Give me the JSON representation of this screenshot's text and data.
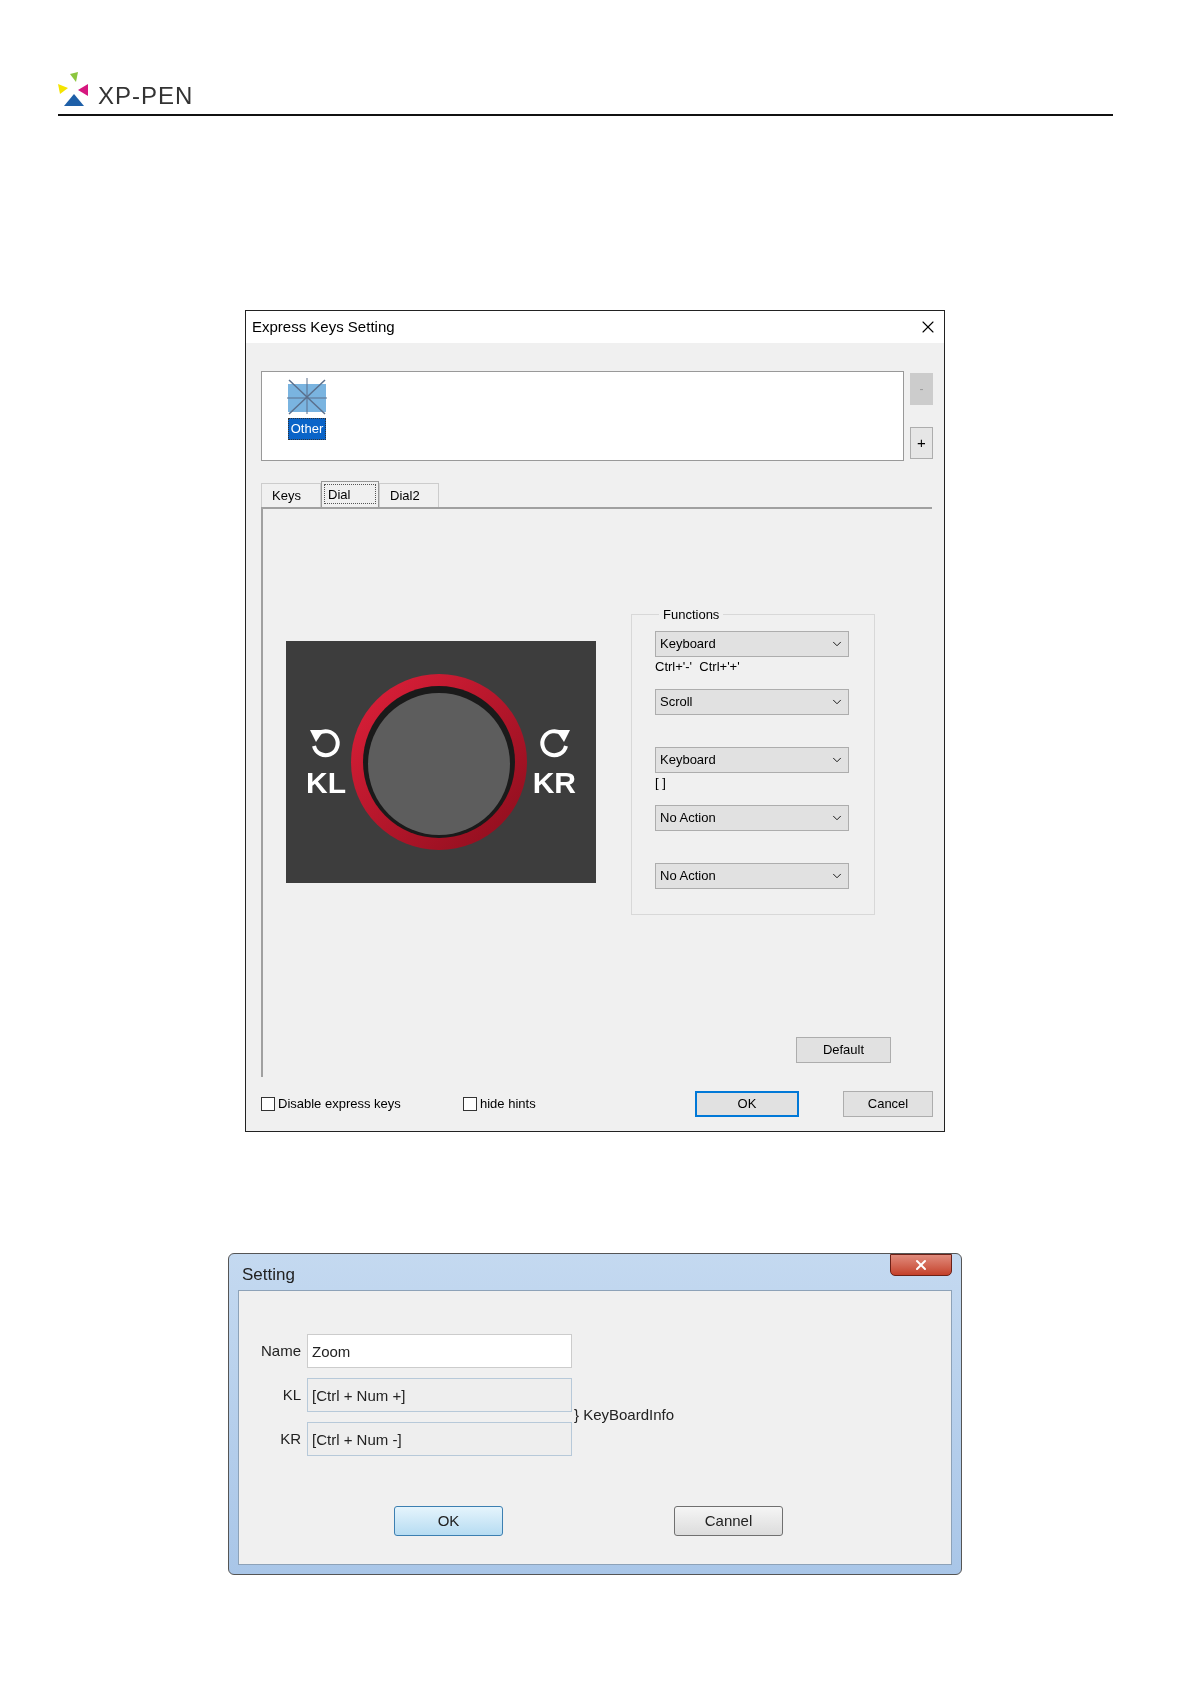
{
  "header": {
    "brand": "XP-PEN"
  },
  "express_keys_dialog": {
    "title": "Express Keys Setting",
    "apps": [
      {
        "label": "Other",
        "selected": true
      }
    ],
    "app_buttons": [
      {
        "label": "-",
        "disabled": true
      },
      {
        "label": "+",
        "disabled": false
      }
    ],
    "tabs": [
      {
        "label": "Keys",
        "selected": false
      },
      {
        "label": "Dial",
        "selected": true
      },
      {
        "label": "Dial2",
        "selected": false
      }
    ],
    "dial_labels": [
      "KL",
      "KR"
    ],
    "functions": {
      "title": "Functions",
      "rows": [
        {
          "value": "Keyboard",
          "hint": "Ctrl+'-'  Ctrl+'+'"
        },
        {
          "value": "Scroll"
        },
        {
          "value": "Keyboard",
          "hint": "[ ]"
        },
        {
          "value": "No Action"
        },
        {
          "value": "No Action"
        }
      ]
    },
    "default_button": "Default",
    "checkboxes": [
      {
        "label": "Disable express keys",
        "checked": false
      },
      {
        "label": "hide hints",
        "checked": false
      }
    ],
    "buttons": [
      {
        "label": "OK",
        "default": true
      },
      {
        "label": "Cancel",
        "default": false
      }
    ]
  },
  "setting_dialog": {
    "title": "Setting",
    "fields": [
      {
        "label": "Name",
        "value": "Zoom",
        "kind": "edit"
      },
      {
        "label": "KL",
        "value": "[Ctrl + Num +]",
        "kind": "readonly"
      },
      {
        "label": "KR",
        "value": "[Ctrl + Num -]",
        "kind": "readonly"
      }
    ],
    "group_label": "} KeyBoardInfo",
    "buttons": [
      {
        "label": "OK",
        "default": true
      },
      {
        "label": "Cannel",
        "default": false
      }
    ]
  }
}
